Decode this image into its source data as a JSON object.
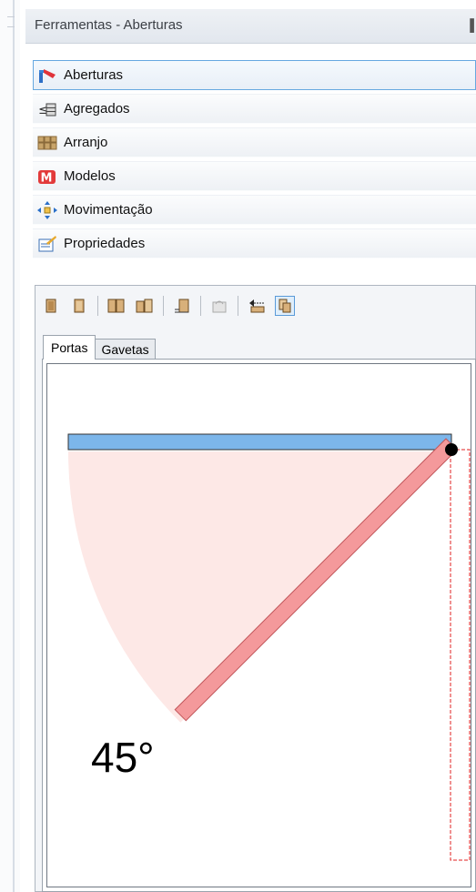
{
  "panel": {
    "title": "Ferramentas - Aberturas",
    "pin_glyph": "▐"
  },
  "tools": [
    {
      "label": "Aberturas",
      "icon": "aberturas-icon",
      "active": true
    },
    {
      "label": "Agregados",
      "icon": "agregados-icon",
      "active": false
    },
    {
      "label": "Arranjo",
      "icon": "arranjo-icon",
      "active": false
    },
    {
      "label": "Modelos",
      "icon": "modelos-icon",
      "active": false
    },
    {
      "label": "Movimentação",
      "icon": "movimentacao-icon",
      "active": false
    },
    {
      "label": "Propriedades",
      "icon": "propriedades-icon",
      "active": false
    }
  ],
  "door_toolbar": {
    "buttons": [
      "door-left-icon",
      "door-right-icon",
      "double-door-icon",
      "double-door-alt-icon",
      "door-align-icon",
      "door-link-disabled-icon",
      "door-move-icon",
      "door-view-icon"
    ],
    "active_button": "door-view-icon"
  },
  "tabs": [
    {
      "label": "Portas",
      "active": true
    },
    {
      "label": "Gavetas",
      "active": false
    }
  ],
  "preview": {
    "angle_label": "45°",
    "opening_angle_deg": 45,
    "colors": {
      "panel_closed": "#7cb6ea",
      "panel_open": "#f4999b",
      "sweep": "#fde8e6",
      "hinge": "#000000",
      "ghost_outline": "#e02020"
    }
  }
}
